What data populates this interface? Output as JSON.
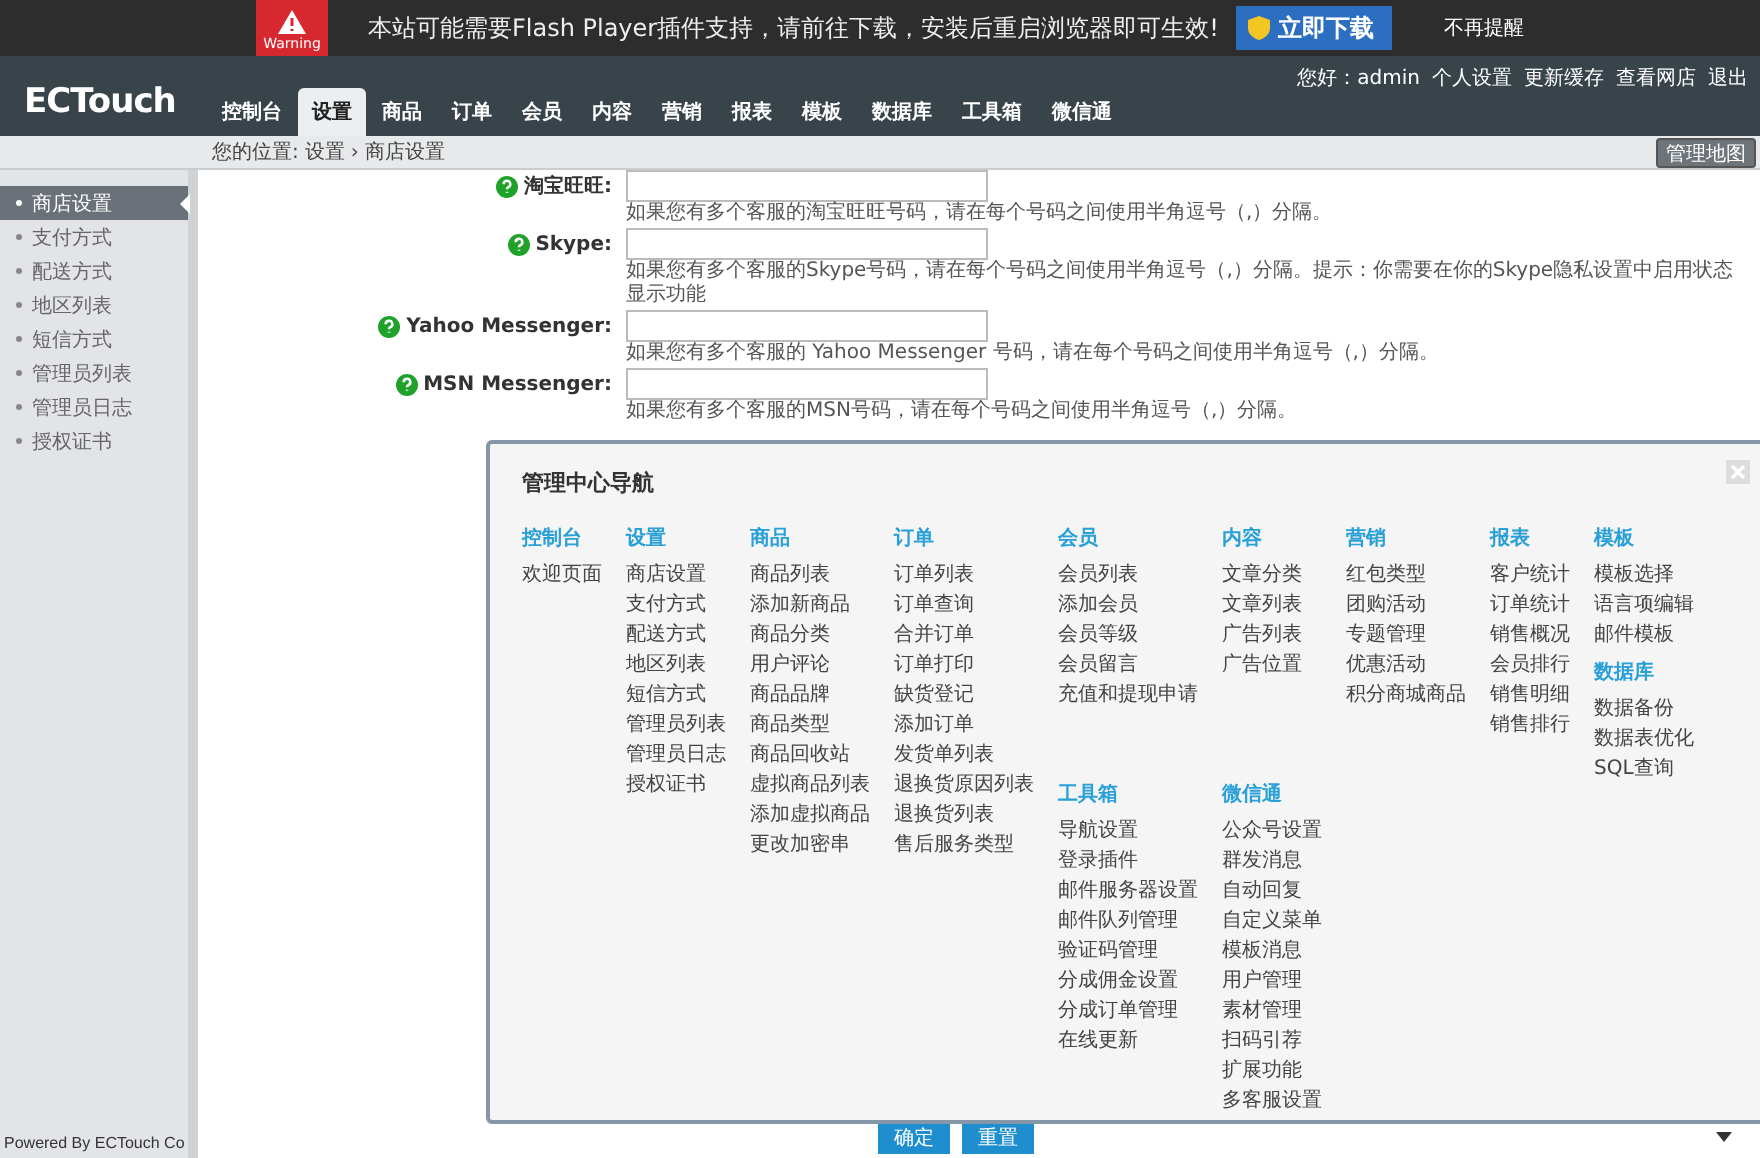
{
  "banner": {
    "badge": "Warning",
    "message": "本站可能需要Flash Player插件支持，请前往下载，安装后重启浏览器即可生效!",
    "download_button": "立即下载",
    "dismiss_link": "不再提醒"
  },
  "header": {
    "logo": "ECTouch",
    "user_links": [
      "您好：admin",
      "个人设置",
      "更新缓存",
      "查看网店",
      "退出"
    ],
    "tabs": [
      {
        "label": "控制台",
        "selected": false
      },
      {
        "label": "设置",
        "selected": true
      },
      {
        "label": "商品",
        "selected": false
      },
      {
        "label": "订单",
        "selected": false
      },
      {
        "label": "会员",
        "selected": false
      },
      {
        "label": "内容",
        "selected": false
      },
      {
        "label": "营销",
        "selected": false
      },
      {
        "label": "报表",
        "selected": false
      },
      {
        "label": "模板",
        "selected": false
      },
      {
        "label": "数据库",
        "selected": false
      },
      {
        "label": "工具箱",
        "selected": false
      },
      {
        "label": "微信通",
        "selected": false
      }
    ]
  },
  "breadcrumb": {
    "prefix": "您的位置:",
    "parent": "设置",
    "separator": "›",
    "current": "商店设置",
    "map_button": "管理地图"
  },
  "sidebar": {
    "items": [
      {
        "label": "商店设置",
        "selected": true
      },
      {
        "label": "支付方式",
        "selected": false
      },
      {
        "label": "配送方式",
        "selected": false
      },
      {
        "label": "地区列表",
        "selected": false
      },
      {
        "label": "短信方式",
        "selected": false
      },
      {
        "label": "管理员列表",
        "selected": false
      },
      {
        "label": "管理员日志",
        "selected": false
      },
      {
        "label": "授权证书",
        "selected": false
      }
    ],
    "footer": "Powered By ECTouch Co"
  },
  "form": {
    "fields": [
      {
        "label": "淘宝旺旺:",
        "hint": "如果您有多个客服的淘宝旺旺号码，请在每个号码之间使用半角逗号（,）分隔。"
      },
      {
        "label": "Skype:",
        "hint": "如果您有多个客服的Skype号码，请在每个号码之间使用半角逗号（,）分隔。提示：你需要在你的Skype隐私设置中启用状态显示功能"
      },
      {
        "label": "Yahoo Messenger:",
        "hint": "如果您有多个客服的 Yahoo Messenger 号码，请在每个号码之间使用半角逗号（,）分隔。"
      },
      {
        "label": "MSN Messenger:",
        "hint": "如果您有多个客服的MSN号码，请在每个号码之间使用半角逗号（,）分隔。"
      }
    ],
    "buttons": [
      "确定",
      "重置"
    ]
  },
  "nav_dialog": {
    "title": "管理中心导航",
    "columns": [
      {
        "groups": [
          {
            "title": "控制台",
            "items": [
              "欢迎页面"
            ]
          }
        ]
      },
      {
        "groups": [
          {
            "title": "设置",
            "items": [
              "商店设置",
              "支付方式",
              "配送方式",
              "地区列表",
              "短信方式",
              "管理员列表",
              "管理员日志",
              "授权证书"
            ]
          }
        ]
      },
      {
        "groups": [
          {
            "title": "商品",
            "items": [
              "商品列表",
              "添加新商品",
              "商品分类",
              "用户评论",
              "商品品牌",
              "商品类型",
              "商品回收站",
              "虚拟商品列表",
              "添加虚拟商品",
              "更改加密串"
            ]
          }
        ]
      },
      {
        "groups": [
          {
            "title": "订单",
            "items": [
              "订单列表",
              "订单查询",
              "合并订单",
              "订单打印",
              "缺货登记",
              "添加订单",
              "发货单列表",
              "退换货原因列表",
              "退换货列表",
              "售后服务类型"
            ]
          }
        ]
      },
      {
        "groups": [
          {
            "title": "会员",
            "items": [
              "会员列表",
              "添加会员",
              "会员等级",
              "会员留言",
              "充值和提现申请"
            ]
          },
          {
            "title": "工具箱",
            "items": [
              "导航设置",
              "登录插件",
              "邮件服务器设置",
              "邮件队列管理",
              "验证码管理",
              "分成佣金设置",
              "分成订单管理",
              "在线更新"
            ]
          }
        ]
      },
      {
        "groups": [
          {
            "title": "内容",
            "items": [
              "文章分类",
              "文章列表",
              "广告列表",
              "广告位置"
            ]
          },
          {
            "title": "微信通",
            "items": [
              "公众号设置",
              "群发消息",
              "自动回复",
              "自定义菜单",
              "模板消息",
              "用户管理",
              "素材管理",
              "扫码引荐",
              "扩展功能",
              "多客服设置"
            ]
          }
        ]
      },
      {
        "groups": [
          {
            "title": "营销",
            "items": [
              "红包类型",
              "团购活动",
              "专题管理",
              "优惠活动",
              "积分商城商品"
            ]
          }
        ]
      },
      {
        "groups": [
          {
            "title": "报表",
            "items": [
              "客户统计",
              "订单统计",
              "销售概况",
              "会员排行",
              "销售明细",
              "销售排行"
            ]
          }
        ]
      },
      {
        "groups": [
          {
            "title": "模板",
            "items": [
              "模板选择",
              "语言项编辑",
              "邮件模板"
            ]
          },
          {
            "title": "数据库",
            "items": [
              "数据备份",
              "数据表优化",
              "SQL查询"
            ]
          }
        ]
      }
    ]
  }
}
